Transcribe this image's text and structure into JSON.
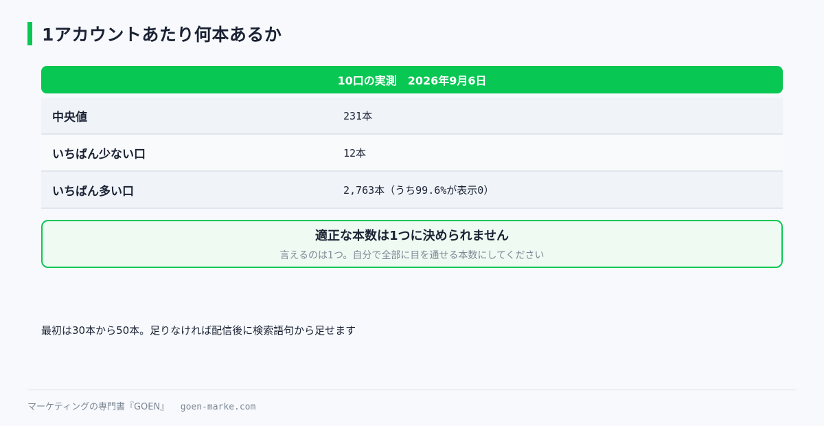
{
  "page": {
    "title": "1アカウントあたり何本あるか"
  },
  "table": {
    "header": "10口の実測　2026年9月6日",
    "rows": [
      {
        "label": "中央値",
        "value": "231本"
      },
      {
        "label": "いちばん少ない口",
        "value": "12本"
      },
      {
        "label": "いちばん多い口",
        "value": "2,763本（うち99.6%が表示0）"
      }
    ]
  },
  "callout": {
    "title": "適正な本数は1つに決められません",
    "subtitle": "言えるのは1つ。自分で全部に目を通せる本数にしてください"
  },
  "note": "最初は30本から50本。足りなければ配信後に検索語句から足せます",
  "footer": {
    "brand": "マーケティングの専門書『GOEN』",
    "url": "goen-marke.com"
  },
  "colors": {
    "accent": "#08c753",
    "text": "#1a2233",
    "muted": "#7d8794",
    "background": "#f7f9fc"
  }
}
